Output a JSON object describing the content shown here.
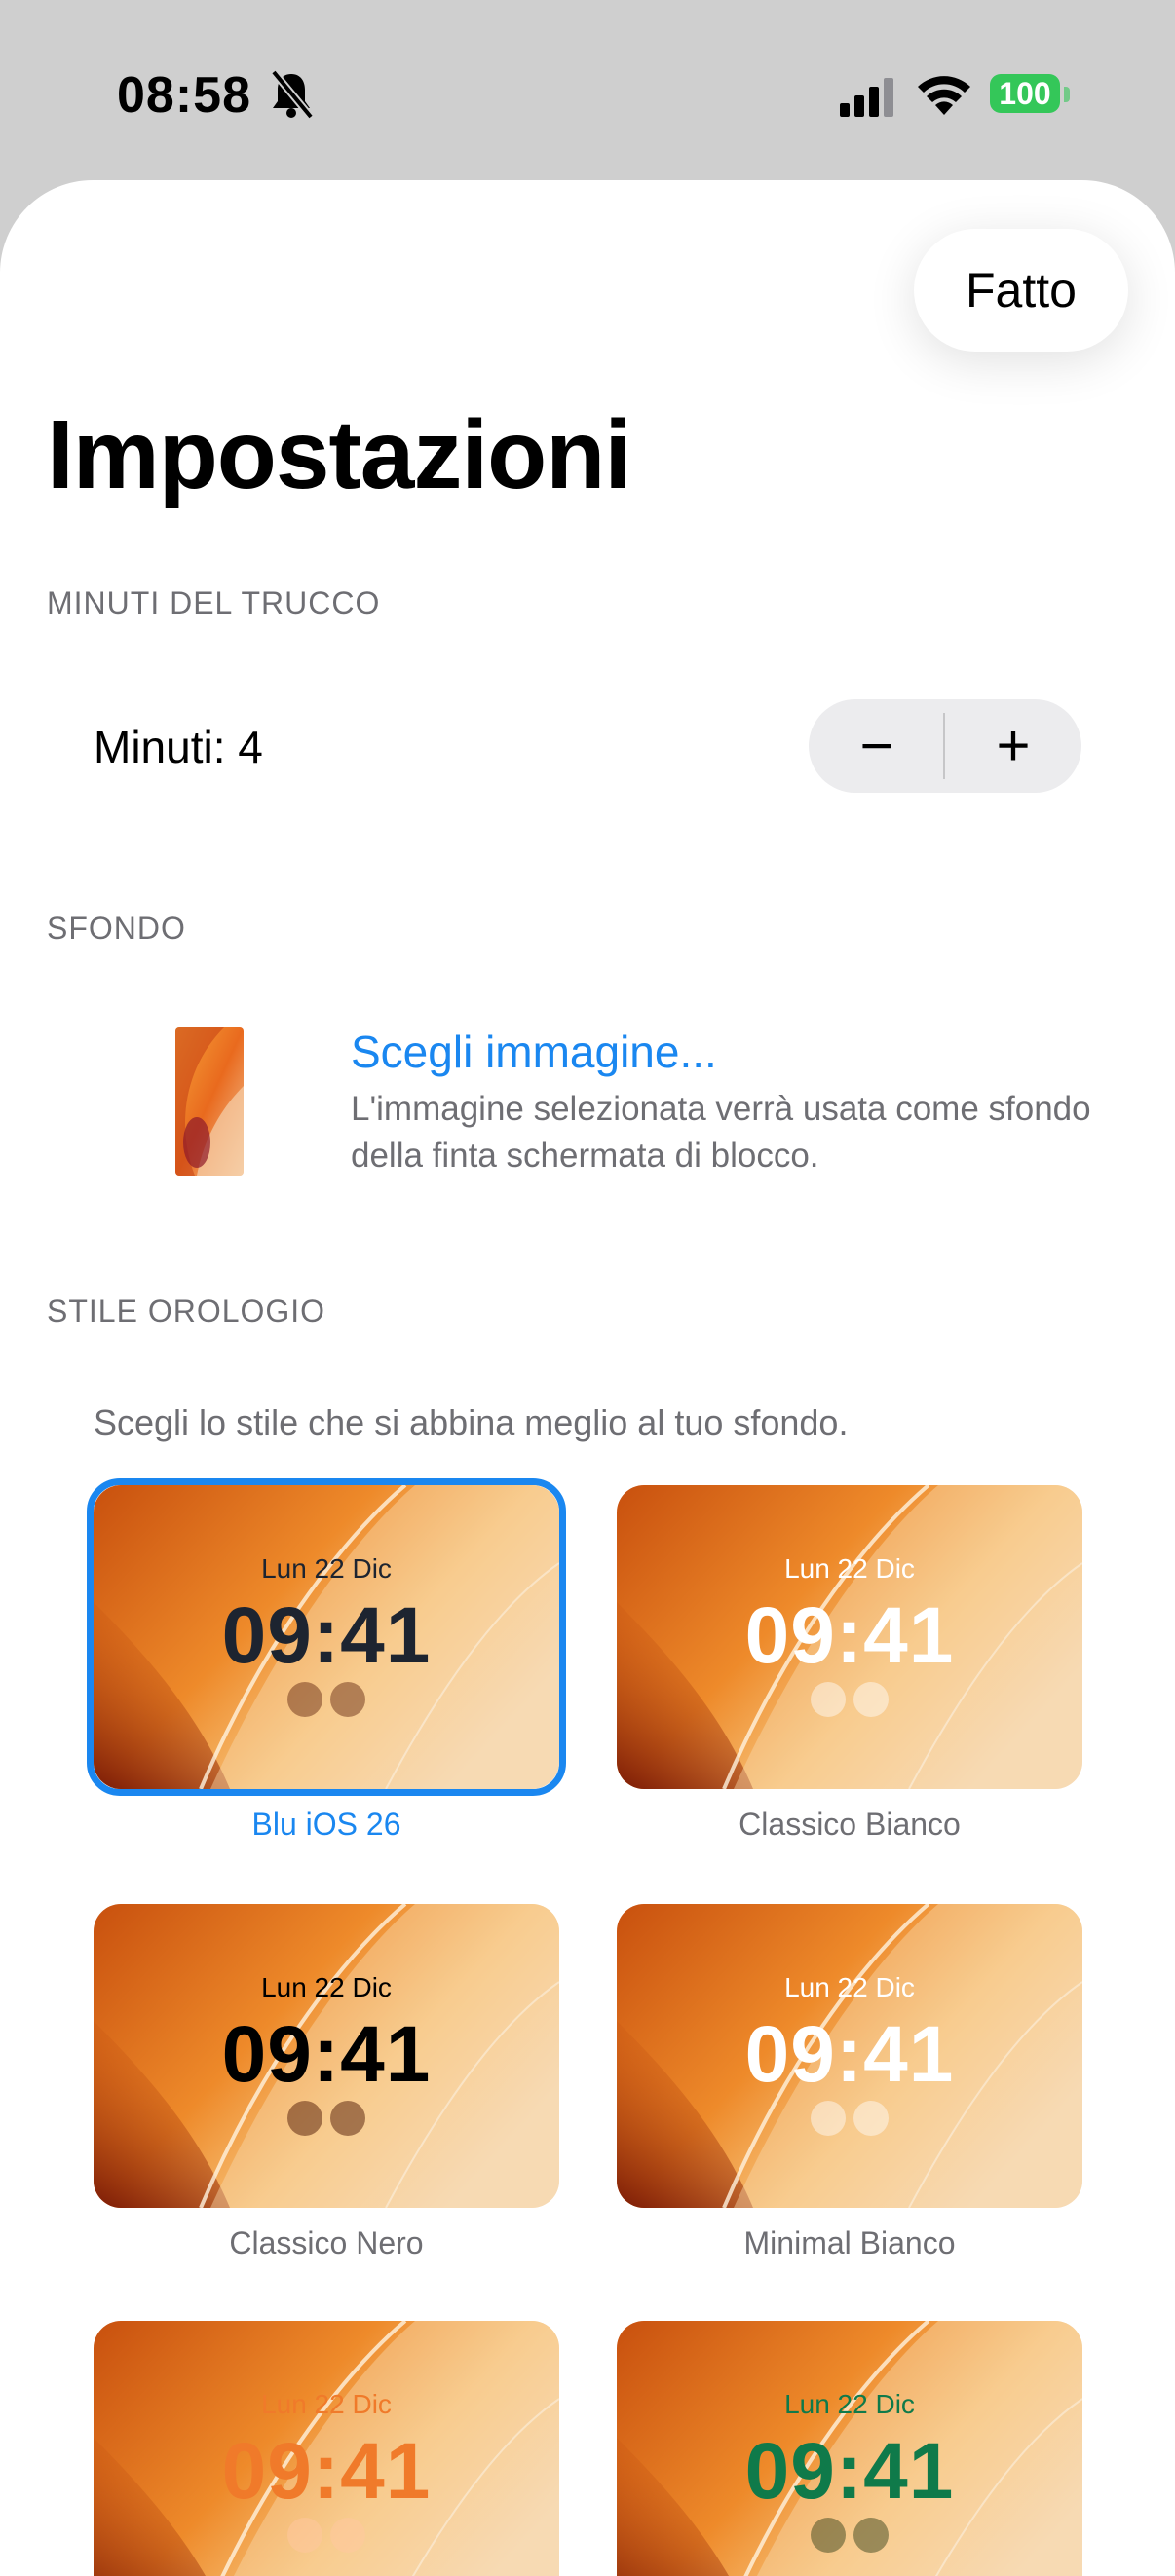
{
  "status_bar": {
    "time": "08:58",
    "battery": "100",
    "battery_color": "#34c759",
    "icons": [
      "bell-slash-icon",
      "cellular-signal-icon",
      "wifi-icon",
      "battery-icon"
    ]
  },
  "sheet": {
    "done_label": "Fatto",
    "title": "Impostazioni"
  },
  "sections": {
    "minutes_header": "MINUTI DEL TRUCCO",
    "background_header": "SFONDO",
    "clock_style_header": "STILE OROLOGIO"
  },
  "minutes": {
    "label": "Minuti: 4",
    "minus_label": "−",
    "plus_label": "+"
  },
  "background": {
    "choose_label": "Scegli immagine...",
    "description": "L'immagine selezionata verrà usata come sfondo della finta schermata di blocco."
  },
  "clock_styles": {
    "hint": "Scegli lo stile che si abbina meglio al tuo sfondo.",
    "preview_date": "Lun 22 Dic",
    "preview_time": "09:41",
    "accent": "#1a87f0",
    "items": [
      {
        "name": "Blu iOS 26",
        "text_color": "#1d2430",
        "dot_color": "rgba(90,30,10,0.45)",
        "selected": true
      },
      {
        "name": "Classico Bianco",
        "text_color": "#ffffff",
        "dot_color": "rgba(255,255,255,0.45)",
        "selected": false
      },
      {
        "name": "Classico Nero",
        "text_color": "#000000",
        "dot_color": "rgba(80,25,5,0.5)",
        "selected": false
      },
      {
        "name": "Minimal Bianco",
        "text_color": "#ffffff",
        "dot_color": "rgba(255,255,255,0.45)",
        "selected": false
      },
      {
        "name": "",
        "text_color": "#f07a2a",
        "dot_color": "rgba(255,200,160,0.5)",
        "selected": false
      },
      {
        "name": "",
        "text_color": "#0f7a4a",
        "dot_color": "rgba(60,70,30,0.5)",
        "selected": false
      }
    ]
  }
}
